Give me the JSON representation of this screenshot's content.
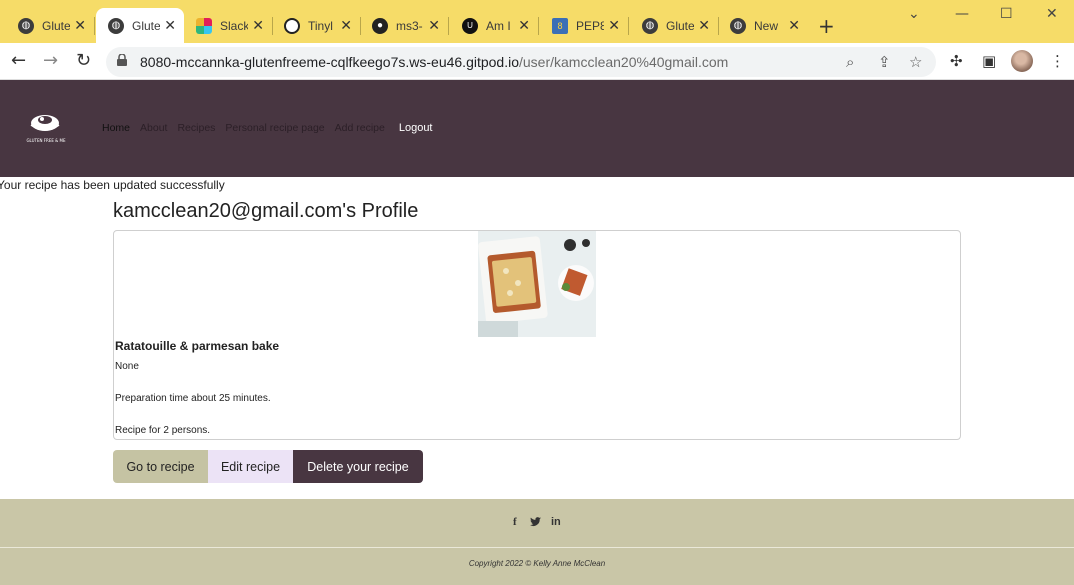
{
  "browser": {
    "tabs": [
      {
        "title": "Glute",
        "icon": "globe-icon",
        "active": false
      },
      {
        "title": "Glute",
        "icon": "globe-icon",
        "active": true
      },
      {
        "title": "Slack",
        "icon": "slack-icon",
        "active": false
      },
      {
        "title": "Tinyl",
        "icon": "panda-icon",
        "active": false
      },
      {
        "title": "ms3-",
        "icon": "github-icon",
        "active": false
      },
      {
        "title": "Am I",
        "icon": "amiresponsive-icon",
        "active": false
      },
      {
        "title": "PEP8",
        "icon": "python-icon",
        "active": false
      },
      {
        "title": "Glute",
        "icon": "globe-icon",
        "active": false
      },
      {
        "title": "New",
        "icon": "globe-icon",
        "active": false
      }
    ],
    "url_host": "8080-mccannka-glutenfreeme-cqlfkeego7s.ws-eu46.gitpod.io",
    "url_path": "/user/kamcclean20%40gmail.com"
  },
  "site": {
    "logo_text": "GLUTEN FREE & ME",
    "nav": {
      "home": "Home",
      "about": "About",
      "recipes": "Recipes",
      "personal": "Personal recipe page",
      "add": "Add recipe",
      "logout": "Logout"
    }
  },
  "main": {
    "flash_message": "Your recipe has been updated successfully",
    "profile_title": "kamcclean20@gmail.com's Profile",
    "recipe": {
      "title": "Ratatouille & parmesan bake",
      "description": "None",
      "prep_time": "Preparation time about 25 minutes.",
      "servings": "Recipe for 2 persons."
    },
    "buttons": {
      "go": "Go to recipe",
      "edit": "Edit recipe",
      "delete": "Delete your recipe"
    }
  },
  "footer": {
    "social": [
      "facebook-icon",
      "twitter-icon",
      "linkedin-icon"
    ],
    "copyright": "Copyright 2022 © Kelly Anne McClean"
  },
  "colors": {
    "tab_bar": "#f6dc68",
    "header": "#483641",
    "footer": "#c9c6a7",
    "btn_go": "#c5c3a3",
    "btn_edit": "#ece3f6",
    "btn_delete": "#483641"
  }
}
